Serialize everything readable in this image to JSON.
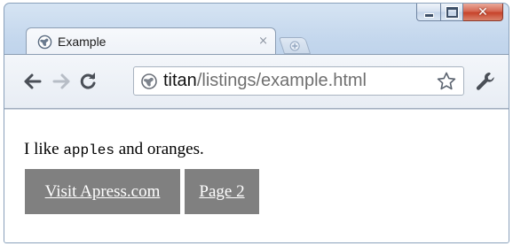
{
  "window": {
    "controls": {
      "minimize_icon": "minimize-icon",
      "maximize_icon": "maximize-icon",
      "close_icon": "close-icon",
      "close_glyph": "✕"
    }
  },
  "tab": {
    "title": "Example",
    "favicon": "globe-icon",
    "close_glyph": "×",
    "new_tab_icon": "new-tab-icon"
  },
  "toolbar": {
    "back_icon": "back-arrow-icon",
    "forward_icon": "forward-arrow-icon",
    "reload_icon": "reload-icon",
    "url_host": "titan",
    "url_path": "/listings/example.html",
    "page_icon": "globe-icon",
    "bookmark_icon": "star-icon",
    "menu_icon": "wrench-icon"
  },
  "page": {
    "text_before": "I like ",
    "code_word": "apples",
    "text_after": " and oranges.",
    "links": [
      {
        "label": "Visit Apress.com"
      },
      {
        "label": "Page 2"
      }
    ]
  },
  "colors": {
    "link_background": "#808080",
    "link_text": "#ffffff",
    "close_button": "#c7432b"
  }
}
